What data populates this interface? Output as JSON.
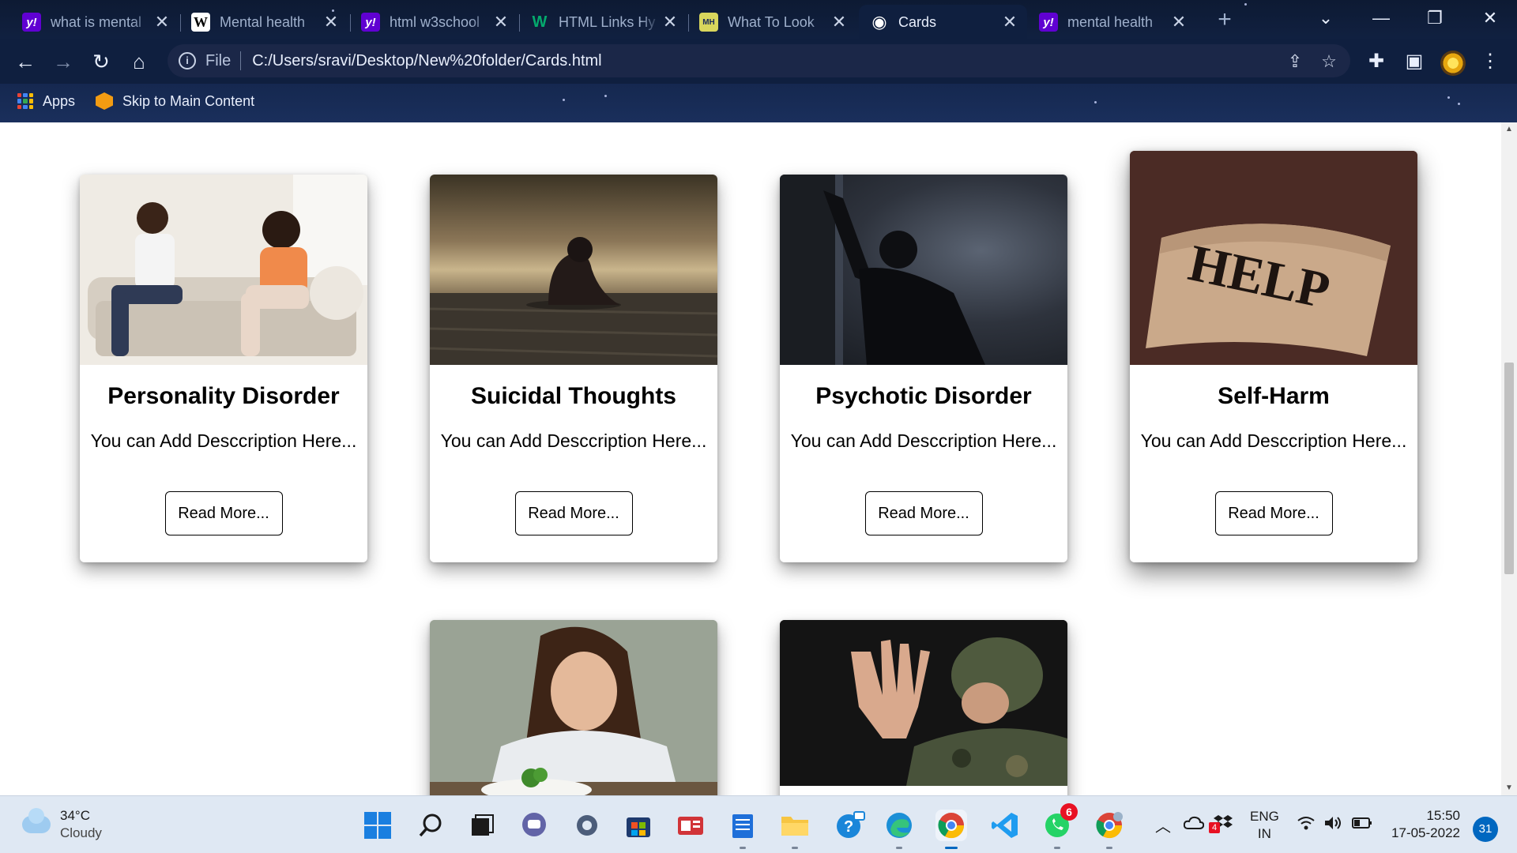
{
  "tabs": [
    {
      "title": "what is mental",
      "favicon": "yahoo-icon",
      "favicon_text": "y!"
    },
    {
      "title": "Mental health",
      "favicon": "wikipedia-icon",
      "favicon_text": "W"
    },
    {
      "title": "html w3school",
      "favicon": "yahoo-icon",
      "favicon_text": "y!"
    },
    {
      "title": "HTML Links Hy",
      "favicon": "w3schools-icon",
      "favicon_text": "W"
    },
    {
      "title": "What To Look",
      "favicon": "mh-icon",
      "favicon_text": "MH"
    },
    {
      "title": "Cards",
      "favicon": "globe-icon",
      "favicon_text": "◉",
      "active": true
    },
    {
      "title": "mental health",
      "favicon": "yahoo-icon",
      "favicon_text": "y!"
    }
  ],
  "window_controls": {
    "tab_search": "⌄",
    "minimize": "—",
    "restore": "❐",
    "close": "✕"
  },
  "toolbar": {
    "back": "←",
    "forward": "→",
    "reload": "↻",
    "home": "⌂",
    "info_icon": "i",
    "scheme": "File",
    "url": "C:/Users/sravi/Desktop/New%20folder/Cards.html",
    "share": "⇪",
    "star": "☆",
    "extensions": "✚",
    "sidepanel": "▣",
    "menu": "⋮"
  },
  "bookmarks": [
    {
      "label": "Apps",
      "icon": "apps-grid-icon"
    },
    {
      "label": "Skip to Main Content",
      "icon": "cube-icon"
    }
  ],
  "cards": [
    {
      "title": "Personality Disorder",
      "description": "You can Add Desccription Here...",
      "button": "Read More...",
      "image": "couple-on-sofa"
    },
    {
      "title": "Suicidal Thoughts",
      "description": "You can Add Desccription Here...",
      "button": "Read More...",
      "image": "person-on-pier"
    },
    {
      "title": "Psychotic Disorder",
      "description": "You can Add Desccription Here...",
      "button": "Read More...",
      "image": "man-against-wall"
    },
    {
      "title": "Self-Harm",
      "description": "You can Add Desccription Here...",
      "button": "Read More...",
      "image": "bandaged-wrist-help",
      "image_text": "HELP"
    },
    {
      "title": "",
      "description": "",
      "button": "",
      "image": "girl-with-plate"
    },
    {
      "title": "",
      "description": "",
      "button": "",
      "image": "soldier-hand-up"
    }
  ],
  "taskbar": {
    "weather": {
      "temp": "34°C",
      "condition": "Cloudy"
    },
    "apps": [
      {
        "name": "start",
        "icon": "windows-icon"
      },
      {
        "name": "search",
        "icon": "search-icon"
      },
      {
        "name": "task-view",
        "icon": "task-view-icon"
      },
      {
        "name": "chat",
        "icon": "chat-icon"
      },
      {
        "name": "settings",
        "icon": "gear-icon"
      },
      {
        "name": "store",
        "icon": "store-icon"
      },
      {
        "name": "news",
        "icon": "news-icon"
      },
      {
        "name": "notepad",
        "icon": "notepad-icon"
      },
      {
        "name": "file-explorer",
        "icon": "folder-icon"
      },
      {
        "name": "helper",
        "icon": "help-icon"
      },
      {
        "name": "edge",
        "icon": "edge-icon"
      },
      {
        "name": "chrome",
        "icon": "chrome-icon",
        "active": true
      },
      {
        "name": "vscode",
        "icon": "vscode-icon"
      },
      {
        "name": "whatsapp",
        "icon": "whatsapp-icon",
        "badge": "6"
      },
      {
        "name": "chrome-profile",
        "icon": "chrome-icon"
      }
    ],
    "tray": {
      "language": "ENG",
      "region": "IN",
      "tray_badge": "4"
    },
    "clock": {
      "time": "15:50",
      "date": "17-05-2022"
    },
    "notifications": "31"
  },
  "colors": {
    "chrome_bg": "#0f1f3f",
    "page_bg": "#ffffff",
    "taskbar_bg": "#dfe8f3",
    "accent": "#0067c0"
  }
}
